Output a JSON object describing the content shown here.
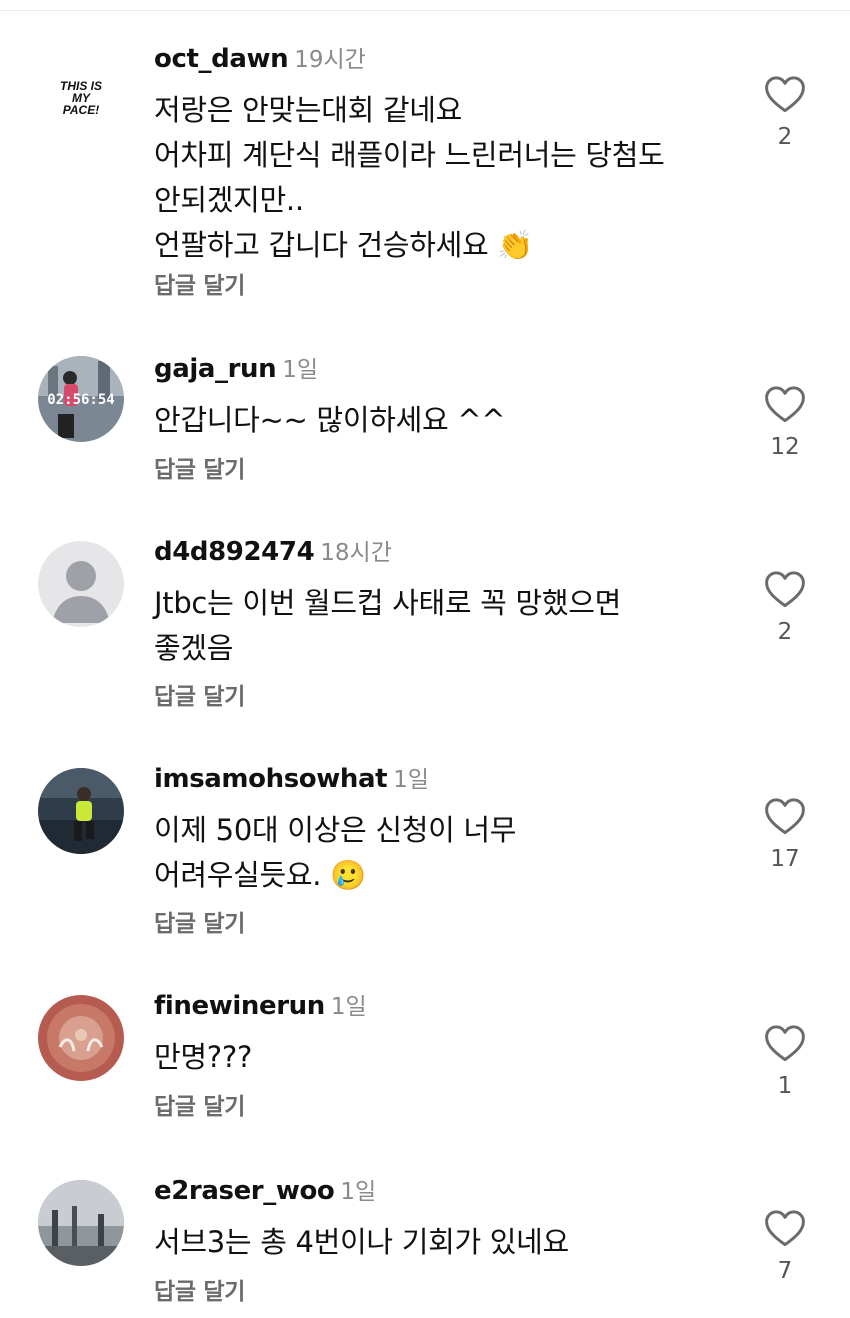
{
  "comments": [
    {
      "username": "oct_dawn",
      "time": "19시간",
      "lines": [
        "저랑은 안맞는대회 같네요",
        "어차피 계단식 래플이라 느린러너는 당첨도",
        "안되겠지만..",
        "언팔하고 갑니다 건승하세요 👏"
      ],
      "reply_label": "답글 달기",
      "likes": "2",
      "avatar_text": "THIS IS MY PACE!"
    },
    {
      "username": "gaja_run",
      "time": "1일",
      "lines": [
        "안갑니다~~ 많이하세요 ^^"
      ],
      "reply_label": "답글 달기",
      "likes": "12",
      "avatar_text": "02:56:54"
    },
    {
      "username": "d4d892474",
      "time": "18시간",
      "lines": [
        "Jtbc는 이번 월드컵 사태로 꼭 망했으면",
        "좋겠음"
      ],
      "reply_label": "답글 달기",
      "likes": "2"
    },
    {
      "username": "imsamohsowhat",
      "time": "1일",
      "lines": [
        "이제 50대 이상은 신청이 너무",
        "어려우실듯요. 🥲"
      ],
      "reply_label": "답글 달기",
      "likes": "17"
    },
    {
      "username": "finewinerun",
      "time": "1일",
      "lines": [
        "만명???"
      ],
      "reply_label": "답글 달기",
      "likes": "1"
    },
    {
      "username": "e2raser_woo",
      "time": "1일",
      "lines": [
        "서브3는 총 4번이나 기회가 있네요"
      ],
      "reply_label": "답글 달기",
      "likes": "7"
    }
  ]
}
